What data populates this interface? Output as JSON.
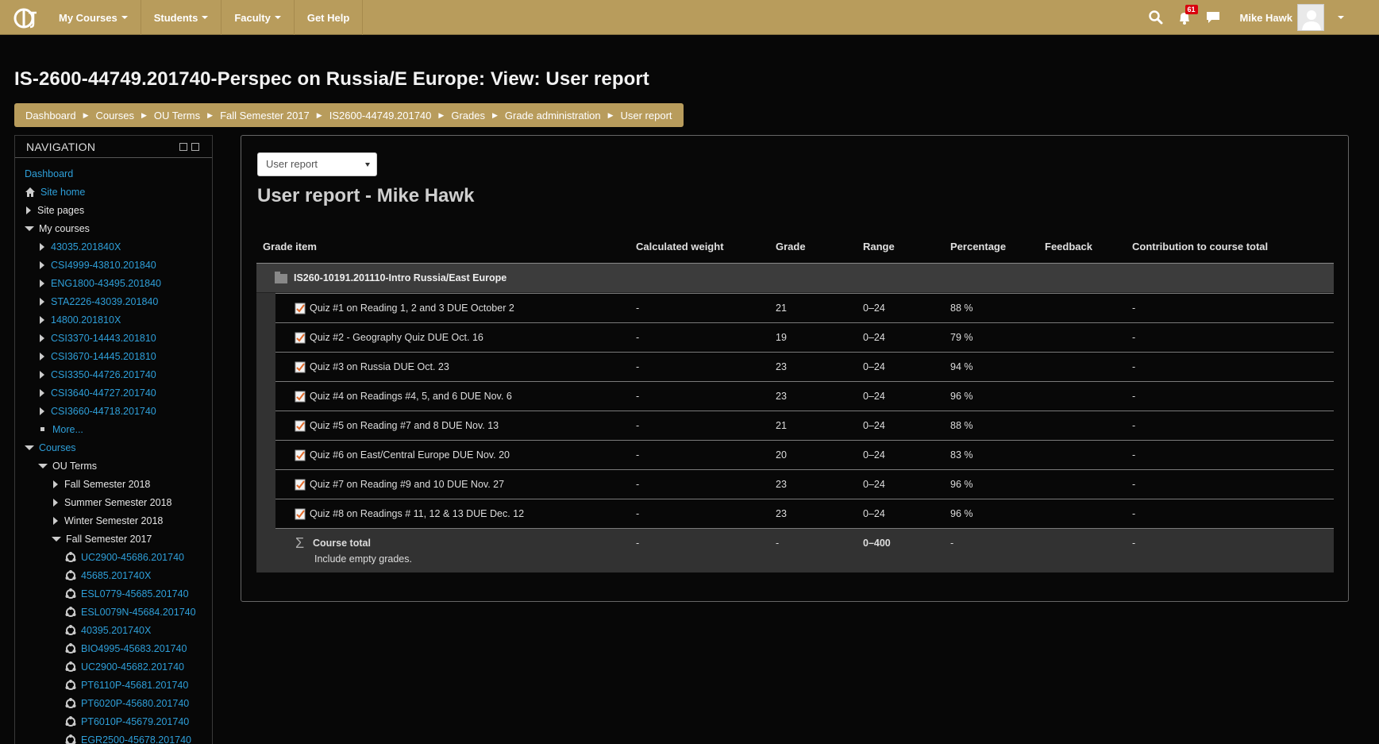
{
  "colors": {
    "accent": "#b89c5c",
    "link": "#2e9fd9",
    "badge": "#d9000d"
  },
  "topbar": {
    "logo_icon": "ou-logo-icon",
    "menu": [
      "My Courses",
      "Students",
      "Faculty",
      "Get Help"
    ],
    "notifications_count": "61",
    "user_name": "Mike Hawk"
  },
  "page_title": "IS-2600-44749.201740-Perspec on Russia/E Europe: View: User report",
  "breadcrumb": [
    "Dashboard",
    "Courses",
    "OU Terms",
    "Fall Semester 2017",
    "IS2600-44749.201740",
    "Grades",
    "Grade administration",
    "User report"
  ],
  "navigation": {
    "title": "NAVIGATION",
    "items": [
      {
        "label": "Dashboard",
        "indent": 0,
        "marker": "none",
        "style": "link"
      },
      {
        "label": "Site home",
        "indent": 0,
        "marker": "home",
        "style": "link"
      },
      {
        "label": "Site pages",
        "indent": 0,
        "marker": "right",
        "style": "plain"
      },
      {
        "label": "My courses",
        "indent": 0,
        "marker": "down",
        "style": "plain"
      },
      {
        "label": "43035.201840X",
        "indent": 1,
        "marker": "right",
        "style": "link"
      },
      {
        "label": "CSI4999-43810.201840",
        "indent": 1,
        "marker": "right",
        "style": "link"
      },
      {
        "label": "ENG1800-43495.201840",
        "indent": 1,
        "marker": "right",
        "style": "link"
      },
      {
        "label": "STA2226-43039.201840",
        "indent": 1,
        "marker": "right",
        "style": "link"
      },
      {
        "label": "14800.201810X",
        "indent": 1,
        "marker": "right",
        "style": "link"
      },
      {
        "label": "CSI3370-14443.201810",
        "indent": 1,
        "marker": "right",
        "style": "link"
      },
      {
        "label": "CSI3670-14445.201810",
        "indent": 1,
        "marker": "right",
        "style": "link"
      },
      {
        "label": "CSI3350-44726.201740",
        "indent": 1,
        "marker": "right",
        "style": "link"
      },
      {
        "label": "CSI3640-44727.201740",
        "indent": 1,
        "marker": "right",
        "style": "link"
      },
      {
        "label": "CSI3660-44718.201740",
        "indent": 1,
        "marker": "right",
        "style": "link"
      },
      {
        "label": "More...",
        "indent": 1,
        "marker": "bullet",
        "style": "link"
      },
      {
        "label": "Courses",
        "indent": 0,
        "marker": "down",
        "style": "link"
      },
      {
        "label": "OU Terms",
        "indent": 1,
        "marker": "down",
        "style": "plain"
      },
      {
        "label": "Fall Semester 2018",
        "indent": 2,
        "marker": "right",
        "style": "plain"
      },
      {
        "label": "Summer Semester 2018",
        "indent": 2,
        "marker": "right",
        "style": "plain"
      },
      {
        "label": "Winter Semester 2018",
        "indent": 2,
        "marker": "right",
        "style": "plain"
      },
      {
        "label": "Fall Semester 2017",
        "indent": 2,
        "marker": "down",
        "style": "plain"
      },
      {
        "label": "UC2900-45686.201740",
        "indent": 3,
        "marker": "course",
        "style": "link"
      },
      {
        "label": "45685.201740X",
        "indent": 3,
        "marker": "course",
        "style": "link"
      },
      {
        "label": "ESL0779-45685.201740",
        "indent": 3,
        "marker": "course",
        "style": "link"
      },
      {
        "label": "ESL0079N-45684.201740",
        "indent": 3,
        "marker": "course",
        "style": "link"
      },
      {
        "label": "40395.201740X",
        "indent": 3,
        "marker": "course",
        "style": "link"
      },
      {
        "label": "BIO4995-45683.201740",
        "indent": 3,
        "marker": "course",
        "style": "link"
      },
      {
        "label": "UC2900-45682.201740",
        "indent": 3,
        "marker": "course",
        "style": "link"
      },
      {
        "label": "PT6110P-45681.201740",
        "indent": 3,
        "marker": "course",
        "style": "link"
      },
      {
        "label": "PT6020P-45680.201740",
        "indent": 3,
        "marker": "course",
        "style": "link"
      },
      {
        "label": "PT6010P-45679.201740",
        "indent": 3,
        "marker": "course",
        "style": "link"
      },
      {
        "label": "EGR2500-45678.201740",
        "indent": 3,
        "marker": "course",
        "style": "link"
      }
    ]
  },
  "report": {
    "selector_value": "User report",
    "title": "User report - Mike Hawk",
    "columns": [
      "Grade item",
      "Calculated weight",
      "Grade",
      "Range",
      "Percentage",
      "Feedback",
      "Contribution to course total"
    ],
    "category": "IS260-10191.201110-Intro Russia/East Europe",
    "rows": [
      {
        "item": "Quiz #1 on Reading 1, 2 and 3 DUE October 2",
        "weight": "-",
        "grade": "21",
        "range": "0–24",
        "percentage": "88 %",
        "feedback": "",
        "contribution": "-"
      },
      {
        "item": "Quiz #2 - Geography Quiz DUE Oct. 16",
        "weight": "-",
        "grade": "19",
        "range": "0–24",
        "percentage": "79 %",
        "feedback": "",
        "contribution": "-"
      },
      {
        "item": "Quiz #3 on Russia DUE Oct. 23",
        "weight": "-",
        "grade": "23",
        "range": "0–24",
        "percentage": "94 %",
        "feedback": "",
        "contribution": "-"
      },
      {
        "item": "Quiz #4 on Readings #4, 5, and 6 DUE Nov. 6",
        "weight": "-",
        "grade": "23",
        "range": "0–24",
        "percentage": "96 %",
        "feedback": "",
        "contribution": "-"
      },
      {
        "item": "Quiz #5 on Reading #7 and 8 DUE Nov. 13",
        "weight": "-",
        "grade": "21",
        "range": "0–24",
        "percentage": "88 %",
        "feedback": "",
        "contribution": "-"
      },
      {
        "item": "Quiz #6 on East/Central Europe DUE Nov. 20",
        "weight": "-",
        "grade": "20",
        "range": "0–24",
        "percentage": "83 %",
        "feedback": "",
        "contribution": "-"
      },
      {
        "item": "Quiz #7 on Reading #9 and 10 DUE Nov. 27",
        "weight": "-",
        "grade": "23",
        "range": "0–24",
        "percentage": "96 %",
        "feedback": "",
        "contribution": "-"
      },
      {
        "item": "Quiz #8 on Readings # 11, 12 & 13 DUE Dec. 12",
        "weight": "-",
        "grade": "23",
        "range": "0–24",
        "percentage": "96 %",
        "feedback": "",
        "contribution": "-"
      }
    ],
    "total": {
      "label": "Course total",
      "note": "Include empty grades.",
      "weight": "-",
      "grade": "-",
      "range": "0–400",
      "percentage": "-",
      "feedback": "",
      "contribution": "-"
    }
  }
}
